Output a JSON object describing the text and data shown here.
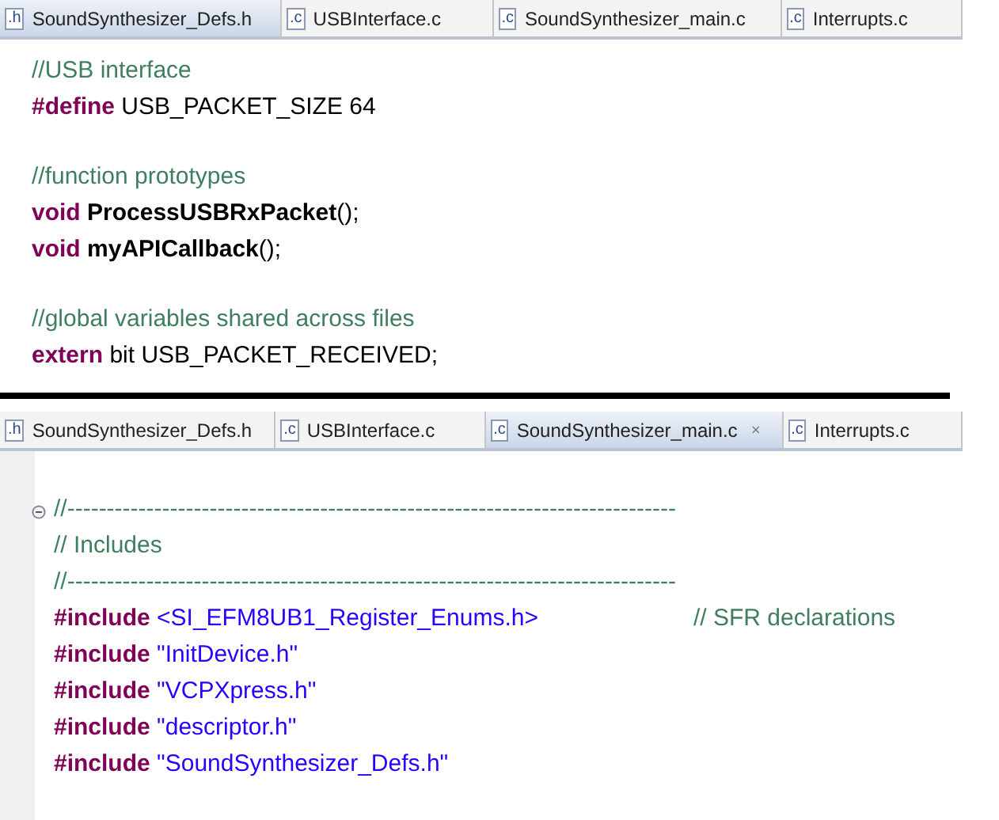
{
  "panels": [
    {
      "tabs": [
        {
          "icon": ".h",
          "label": "SoundSynthesizer_Defs.h",
          "selected": true
        },
        {
          "icon": ".c",
          "label": "USBInterface.c",
          "selected": false
        },
        {
          "icon": ".c",
          "label": "SoundSynthesizer_main.c",
          "selected": false
        },
        {
          "icon": ".c",
          "label": "Interrupts.c",
          "selected": false
        }
      ],
      "folding": false,
      "blocks": [
        {
          "lines": [
            {
              "tokens": [
                {
                  "kind": "comment",
                  "text": "//USB interface"
                }
              ]
            },
            {
              "tokens": [
                {
                  "kind": "keyword",
                  "text": "#define"
                },
                {
                  "kind": "plain",
                  "text": " USB_PACKET_SIZE 64"
                }
              ]
            }
          ]
        },
        {
          "lines": [
            {
              "tokens": [
                {
                  "kind": "comment",
                  "text": "//function prototypes"
                }
              ]
            },
            {
              "tokens": [
                {
                  "kind": "keyword",
                  "text": "void"
                },
                {
                  "kind": "bold",
                  "text": " ProcessUSBRxPacket"
                },
                {
                  "kind": "plain",
                  "text": "();"
                }
              ]
            },
            {
              "tokens": [
                {
                  "kind": "keyword",
                  "text": "void"
                },
                {
                  "kind": "bold",
                  "text": " myAPICallback"
                },
                {
                  "kind": "plain",
                  "text": "();"
                }
              ]
            }
          ]
        },
        {
          "lines": [
            {
              "tokens": [
                {
                  "kind": "comment",
                  "text": "//global variables shared across files"
                }
              ]
            },
            {
              "tokens": [
                {
                  "kind": "keyword",
                  "text": "extern"
                },
                {
                  "kind": "plain",
                  "text": " bit USB_PACKET_RECEIVED;"
                }
              ]
            }
          ]
        }
      ]
    },
    {
      "tabs": [
        {
          "icon": ".h",
          "label": "SoundSynthesizer_Defs.h",
          "selected": false
        },
        {
          "icon": ".c",
          "label": "USBInterface.c",
          "selected": false
        },
        {
          "icon": ".c",
          "label": "SoundSynthesizer_main.c",
          "selected": true
        },
        {
          "icon": ".c",
          "label": "Interrupts.c",
          "selected": false
        }
      ],
      "folding": true,
      "blocks": [
        {
          "lines": [
            {
              "tokens": [
                {
                  "kind": "comment",
                  "text": "//-----------------------------------------------------------------------------"
                }
              ]
            },
            {
              "tokens": [
                {
                  "kind": "comment",
                  "text": "// Includes"
                }
              ]
            },
            {
              "tokens": [
                {
                  "kind": "comment",
                  "text": "//-----------------------------------------------------------------------------"
                }
              ]
            },
            {
              "tokens": [
                {
                  "kind": "keyword",
                  "text": "#include"
                },
                {
                  "kind": "string",
                  "text": " <SI_EFM8UB1_Register_Enums.h>"
                },
                {
                  "kind": "trailing_comment",
                  "text": "// SFR declarations"
                }
              ]
            },
            {
              "tokens": [
                {
                  "kind": "keyword",
                  "text": "#include"
                },
                {
                  "kind": "string",
                  "text": " \"InitDevice.h\""
                }
              ]
            },
            {
              "tokens": [
                {
                  "kind": "keyword",
                  "text": "#include"
                },
                {
                  "kind": "string",
                  "text": " \"VCPXpress.h\""
                }
              ]
            },
            {
              "tokens": [
                {
                  "kind": "keyword",
                  "text": "#include"
                },
                {
                  "kind": "string",
                  "text": " \"descriptor.h\""
                }
              ]
            },
            {
              "tokens": [
                {
                  "kind": "keyword",
                  "text": "#include"
                },
                {
                  "kind": "string",
                  "text": " \"SoundSynthesizer_Defs.h\""
                }
              ]
            }
          ]
        }
      ]
    }
  ]
}
